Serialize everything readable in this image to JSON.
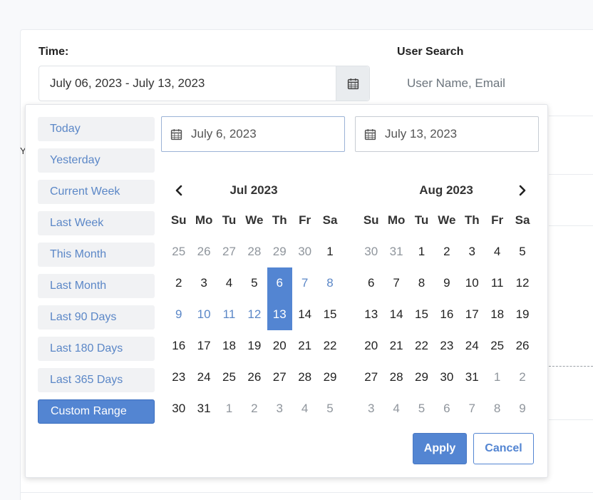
{
  "filters": {
    "time_label": "Time:",
    "time_value": "July 06, 2023 - July 13, 2023",
    "user_search_label": "User Search",
    "user_search_placeholder": "User Name, Email"
  },
  "background": {
    "letter": "Y"
  },
  "picker": {
    "ranges": [
      "Today",
      "Yesterday",
      "Current Week",
      "Last Week",
      "This Month",
      "Last Month",
      "Last 90 Days",
      "Last 180 Days",
      "Last 365 Days",
      "Custom Range"
    ],
    "active_range": "Custom Range",
    "start_date": "July 6, 2023",
    "end_date": "July 13, 2023",
    "weekdays": [
      "Su",
      "Mo",
      "Tu",
      "We",
      "Th",
      "Fr",
      "Sa"
    ],
    "left_month": {
      "title": "Jul 2023",
      "days": [
        {
          "d": "25",
          "s": "off"
        },
        {
          "d": "26",
          "s": "off"
        },
        {
          "d": "27",
          "s": "off"
        },
        {
          "d": "28",
          "s": "off"
        },
        {
          "d": "29",
          "s": "off"
        },
        {
          "d": "30",
          "s": "off"
        },
        {
          "d": "1",
          "s": ""
        },
        {
          "d": "2",
          "s": ""
        },
        {
          "d": "3",
          "s": ""
        },
        {
          "d": "4",
          "s": ""
        },
        {
          "d": "5",
          "s": ""
        },
        {
          "d": "6",
          "s": "sel"
        },
        {
          "d": "7",
          "s": "range"
        },
        {
          "d": "8",
          "s": "range"
        },
        {
          "d": "9",
          "s": "range"
        },
        {
          "d": "10",
          "s": "range"
        },
        {
          "d": "11",
          "s": "range"
        },
        {
          "d": "12",
          "s": "range"
        },
        {
          "d": "13",
          "s": "sel"
        },
        {
          "d": "14",
          "s": ""
        },
        {
          "d": "15",
          "s": ""
        },
        {
          "d": "16",
          "s": ""
        },
        {
          "d": "17",
          "s": ""
        },
        {
          "d": "18",
          "s": ""
        },
        {
          "d": "19",
          "s": ""
        },
        {
          "d": "20",
          "s": ""
        },
        {
          "d": "21",
          "s": ""
        },
        {
          "d": "22",
          "s": ""
        },
        {
          "d": "23",
          "s": ""
        },
        {
          "d": "24",
          "s": ""
        },
        {
          "d": "25",
          "s": ""
        },
        {
          "d": "26",
          "s": ""
        },
        {
          "d": "27",
          "s": ""
        },
        {
          "d": "28",
          "s": ""
        },
        {
          "d": "29",
          "s": ""
        },
        {
          "d": "30",
          "s": ""
        },
        {
          "d": "31",
          "s": ""
        },
        {
          "d": "1",
          "s": "off"
        },
        {
          "d": "2",
          "s": "off"
        },
        {
          "d": "3",
          "s": "off"
        },
        {
          "d": "4",
          "s": "off"
        },
        {
          "d": "5",
          "s": "off"
        }
      ]
    },
    "right_month": {
      "title": "Aug 2023",
      "days": [
        {
          "d": "30",
          "s": "off"
        },
        {
          "d": "31",
          "s": "off"
        },
        {
          "d": "1",
          "s": ""
        },
        {
          "d": "2",
          "s": ""
        },
        {
          "d": "3",
          "s": ""
        },
        {
          "d": "4",
          "s": ""
        },
        {
          "d": "5",
          "s": ""
        },
        {
          "d": "6",
          "s": ""
        },
        {
          "d": "7",
          "s": ""
        },
        {
          "d": "8",
          "s": ""
        },
        {
          "d": "9",
          "s": ""
        },
        {
          "d": "10",
          "s": ""
        },
        {
          "d": "11",
          "s": ""
        },
        {
          "d": "12",
          "s": ""
        },
        {
          "d": "13",
          "s": ""
        },
        {
          "d": "14",
          "s": ""
        },
        {
          "d": "15",
          "s": ""
        },
        {
          "d": "16",
          "s": ""
        },
        {
          "d": "17",
          "s": ""
        },
        {
          "d": "18",
          "s": ""
        },
        {
          "d": "19",
          "s": ""
        },
        {
          "d": "20",
          "s": ""
        },
        {
          "d": "21",
          "s": ""
        },
        {
          "d": "22",
          "s": ""
        },
        {
          "d": "23",
          "s": ""
        },
        {
          "d": "24",
          "s": ""
        },
        {
          "d": "25",
          "s": ""
        },
        {
          "d": "26",
          "s": ""
        },
        {
          "d": "27",
          "s": ""
        },
        {
          "d": "28",
          "s": ""
        },
        {
          "d": "29",
          "s": ""
        },
        {
          "d": "30",
          "s": ""
        },
        {
          "d": "31",
          "s": ""
        },
        {
          "d": "1",
          "s": "off"
        },
        {
          "d": "2",
          "s": "off"
        },
        {
          "d": "3",
          "s": "off"
        },
        {
          "d": "4",
          "s": "off"
        },
        {
          "d": "5",
          "s": "off"
        },
        {
          "d": "6",
          "s": "off"
        },
        {
          "d": "7",
          "s": "off"
        },
        {
          "d": "8",
          "s": "off"
        },
        {
          "d": "9",
          "s": "off"
        }
      ]
    },
    "apply_label": "Apply",
    "cancel_label": "Cancel"
  },
  "colors": {
    "accent": "#5385d2",
    "range_text": "#5b87c7",
    "muted": "#8f959c"
  },
  "icons": {
    "calendar": "calendar-icon",
    "prev": "chevron-left-icon",
    "next": "chevron-right-icon"
  }
}
